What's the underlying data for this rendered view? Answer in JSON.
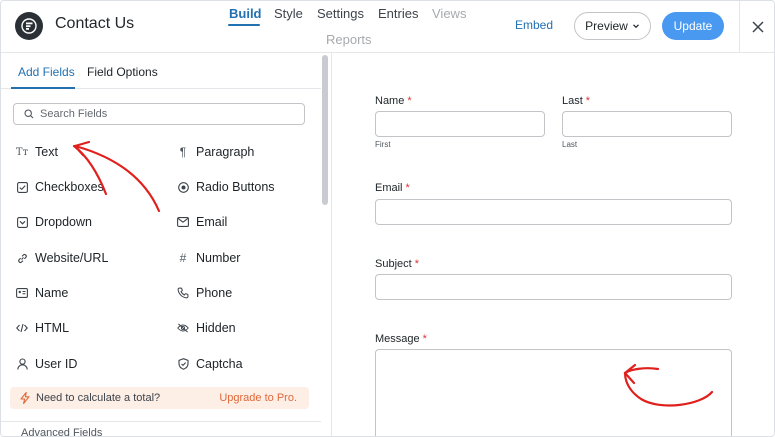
{
  "header": {
    "title": "Contact Us",
    "nav": [
      "Build",
      "Style",
      "Settings",
      "Entries",
      "Views",
      "Reports"
    ],
    "embed": "Embed",
    "preview": "Preview",
    "update": "Update"
  },
  "sidebar": {
    "tabs": [
      "Add Fields",
      "Field Options"
    ],
    "search_placeholder": "Search Fields",
    "fields_left": [
      "Text",
      "Checkboxes",
      "Dropdown",
      "Website/URL",
      "Name",
      "HTML",
      "User ID"
    ],
    "fields_right": [
      "Paragraph",
      "Radio Buttons",
      "Email",
      "Number",
      "Phone",
      "Hidden",
      "Captcha"
    ],
    "icons_left": [
      "text-size-icon",
      "checkbox-icon",
      "dropdown-icon",
      "link-icon",
      "name-card-icon",
      "code-icon",
      "user-icon"
    ],
    "icons_right": [
      "paragraph-icon",
      "radio-icon",
      "email-icon",
      "hash-icon",
      "phone-icon",
      "eye-slash-icon",
      "shield-icon"
    ],
    "pro_text": "Need to calculate a total?",
    "pro_link": "Upgrade to Pro.",
    "advanced": "Advanced Fields"
  },
  "form": {
    "name_label": "Name",
    "last_label": "Last",
    "first_sub": "First",
    "last_sub": "Last",
    "email_label": "Email",
    "subject_label": "Subject",
    "message_label": "Message",
    "required_mark": "*"
  },
  "colors": {
    "accent": "#2271b1",
    "update_button": "#4a99f0",
    "required": "#d63638",
    "annotation": "#e0201c",
    "pro_banner": "#fdeee6"
  }
}
